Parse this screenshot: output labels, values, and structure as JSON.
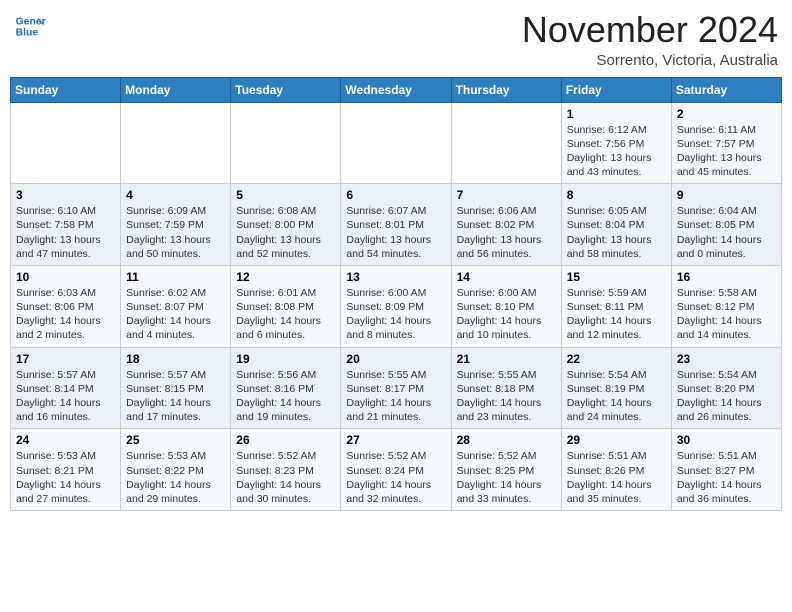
{
  "header": {
    "logo_line1": "General",
    "logo_line2": "Blue",
    "month": "November 2024",
    "location": "Sorrento, Victoria, Australia"
  },
  "weekdays": [
    "Sunday",
    "Monday",
    "Tuesday",
    "Wednesday",
    "Thursday",
    "Friday",
    "Saturday"
  ],
  "weeks": [
    [
      {
        "day": "",
        "text": ""
      },
      {
        "day": "",
        "text": ""
      },
      {
        "day": "",
        "text": ""
      },
      {
        "day": "",
        "text": ""
      },
      {
        "day": "",
        "text": ""
      },
      {
        "day": "1",
        "text": "Sunrise: 6:12 AM\nSunset: 7:56 PM\nDaylight: 13 hours\nand 43 minutes."
      },
      {
        "day": "2",
        "text": "Sunrise: 6:11 AM\nSunset: 7:57 PM\nDaylight: 13 hours\nand 45 minutes."
      }
    ],
    [
      {
        "day": "3",
        "text": "Sunrise: 6:10 AM\nSunset: 7:58 PM\nDaylight: 13 hours\nand 47 minutes."
      },
      {
        "day": "4",
        "text": "Sunrise: 6:09 AM\nSunset: 7:59 PM\nDaylight: 13 hours\nand 50 minutes."
      },
      {
        "day": "5",
        "text": "Sunrise: 6:08 AM\nSunset: 8:00 PM\nDaylight: 13 hours\nand 52 minutes."
      },
      {
        "day": "6",
        "text": "Sunrise: 6:07 AM\nSunset: 8:01 PM\nDaylight: 13 hours\nand 54 minutes."
      },
      {
        "day": "7",
        "text": "Sunrise: 6:06 AM\nSunset: 8:02 PM\nDaylight: 13 hours\nand 56 minutes."
      },
      {
        "day": "8",
        "text": "Sunrise: 6:05 AM\nSunset: 8:04 PM\nDaylight: 13 hours\nand 58 minutes."
      },
      {
        "day": "9",
        "text": "Sunrise: 6:04 AM\nSunset: 8:05 PM\nDaylight: 14 hours\nand 0 minutes."
      }
    ],
    [
      {
        "day": "10",
        "text": "Sunrise: 6:03 AM\nSunset: 8:06 PM\nDaylight: 14 hours\nand 2 minutes."
      },
      {
        "day": "11",
        "text": "Sunrise: 6:02 AM\nSunset: 8:07 PM\nDaylight: 14 hours\nand 4 minutes."
      },
      {
        "day": "12",
        "text": "Sunrise: 6:01 AM\nSunset: 8:08 PM\nDaylight: 14 hours\nand 6 minutes."
      },
      {
        "day": "13",
        "text": "Sunrise: 6:00 AM\nSunset: 8:09 PM\nDaylight: 14 hours\nand 8 minutes."
      },
      {
        "day": "14",
        "text": "Sunrise: 6:00 AM\nSunset: 8:10 PM\nDaylight: 14 hours\nand 10 minutes."
      },
      {
        "day": "15",
        "text": "Sunrise: 5:59 AM\nSunset: 8:11 PM\nDaylight: 14 hours\nand 12 minutes."
      },
      {
        "day": "16",
        "text": "Sunrise: 5:58 AM\nSunset: 8:12 PM\nDaylight: 14 hours\nand 14 minutes."
      }
    ],
    [
      {
        "day": "17",
        "text": "Sunrise: 5:57 AM\nSunset: 8:14 PM\nDaylight: 14 hours\nand 16 minutes."
      },
      {
        "day": "18",
        "text": "Sunrise: 5:57 AM\nSunset: 8:15 PM\nDaylight: 14 hours\nand 17 minutes."
      },
      {
        "day": "19",
        "text": "Sunrise: 5:56 AM\nSunset: 8:16 PM\nDaylight: 14 hours\nand 19 minutes."
      },
      {
        "day": "20",
        "text": "Sunrise: 5:55 AM\nSunset: 8:17 PM\nDaylight: 14 hours\nand 21 minutes."
      },
      {
        "day": "21",
        "text": "Sunrise: 5:55 AM\nSunset: 8:18 PM\nDaylight: 14 hours\nand 23 minutes."
      },
      {
        "day": "22",
        "text": "Sunrise: 5:54 AM\nSunset: 8:19 PM\nDaylight: 14 hours\nand 24 minutes."
      },
      {
        "day": "23",
        "text": "Sunrise: 5:54 AM\nSunset: 8:20 PM\nDaylight: 14 hours\nand 26 minutes."
      }
    ],
    [
      {
        "day": "24",
        "text": "Sunrise: 5:53 AM\nSunset: 8:21 PM\nDaylight: 14 hours\nand 27 minutes."
      },
      {
        "day": "25",
        "text": "Sunrise: 5:53 AM\nSunset: 8:22 PM\nDaylight: 14 hours\nand 29 minutes."
      },
      {
        "day": "26",
        "text": "Sunrise: 5:52 AM\nSunset: 8:23 PM\nDaylight: 14 hours\nand 30 minutes."
      },
      {
        "day": "27",
        "text": "Sunrise: 5:52 AM\nSunset: 8:24 PM\nDaylight: 14 hours\nand 32 minutes."
      },
      {
        "day": "28",
        "text": "Sunrise: 5:52 AM\nSunset: 8:25 PM\nDaylight: 14 hours\nand 33 minutes."
      },
      {
        "day": "29",
        "text": "Sunrise: 5:51 AM\nSunset: 8:26 PM\nDaylight: 14 hours\nand 35 minutes."
      },
      {
        "day": "30",
        "text": "Sunrise: 5:51 AM\nSunset: 8:27 PM\nDaylight: 14 hours\nand 36 minutes."
      }
    ]
  ]
}
